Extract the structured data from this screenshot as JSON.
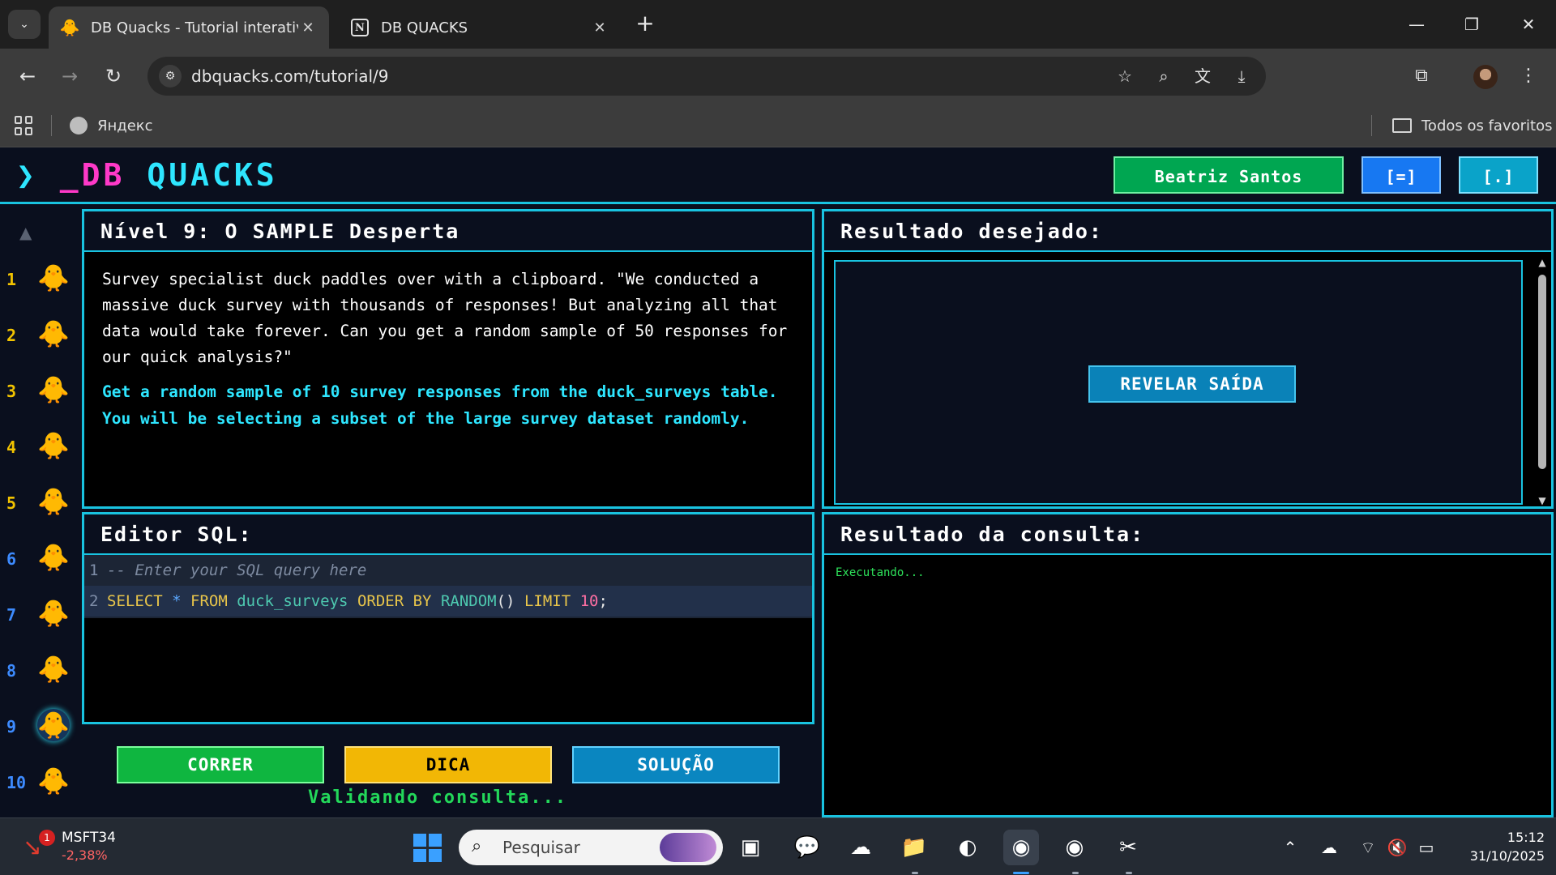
{
  "browser": {
    "tabs": [
      {
        "title": "DB Quacks - Tutorial interativo",
        "active": true,
        "favicon": "duck-icon"
      },
      {
        "title": "DB QUACKS",
        "active": false,
        "favicon": "notion-icon"
      }
    ],
    "url": "dbquacks.com/tutorial/9",
    "bookmarks": [
      {
        "label": "Яндекс",
        "icon": "globe-icon"
      }
    ],
    "all_bookmarks_label": "Todos os favoritos"
  },
  "app": {
    "logo": {
      "chevron": "❯",
      "db": "_DB",
      "quacks": "QUACKS"
    },
    "header": {
      "user_name": "Beatriz Santos",
      "btn1": "[=]",
      "btn2": "[.]"
    },
    "levels": {
      "up_arrow": "▲",
      "items": [
        {
          "number": "1"
        },
        {
          "number": "2"
        },
        {
          "number": "3"
        },
        {
          "number": "4"
        },
        {
          "number": "5"
        },
        {
          "number": "6"
        },
        {
          "number": "7"
        },
        {
          "number": "8"
        },
        {
          "number": "9"
        },
        {
          "number": "10"
        }
      ],
      "current": "9"
    },
    "story_panel": {
      "title": "Nível 9: O SAMPLE Desperta",
      "story": "Survey specialist duck paddles over with a clipboard. \"We conducted a massive duck survey with thousands of responses! But analyzing all that data would take forever. Can you get a random sample of 50 responses for our quick analysis?\"",
      "task": "Get a random sample of 10 survey responses from the duck_surveys table. You will be selecting a subset of the large survey dataset randomly."
    },
    "desired_panel": {
      "title": "Resultado desejado:",
      "reveal_label": "REVELAR SAÍDA"
    },
    "editor": {
      "title": "Editor SQL:",
      "lines": [
        {
          "number": "1",
          "text": "-- Enter your SQL query here"
        },
        {
          "number": "2",
          "text": "SELECT * FROM duck_surveys ORDER BY RANDOM() LIMIT 10;"
        }
      ]
    },
    "result_panel": {
      "title": "Resultado da consulta:",
      "status": "Executando..."
    },
    "actions": {
      "run": "CORRER",
      "hint": "DICA",
      "solution": "SOLUÇÃO"
    },
    "validating_text": "Validando consulta..."
  },
  "taskbar": {
    "stock": {
      "symbol": "MSFT34",
      "change": "-2,38%",
      "badge": "1"
    },
    "search_placeholder": "Pesquisar",
    "time": "15:12",
    "date": "31/10/2025"
  },
  "colors": {
    "accent_cyan": "#19c3e0",
    "run_green": "#0fb640",
    "hint_yellow": "#f2b705",
    "solution_blue": "#0a86c0",
    "user_green": "#00a651",
    "logo_pink": "#ff39c8"
  }
}
